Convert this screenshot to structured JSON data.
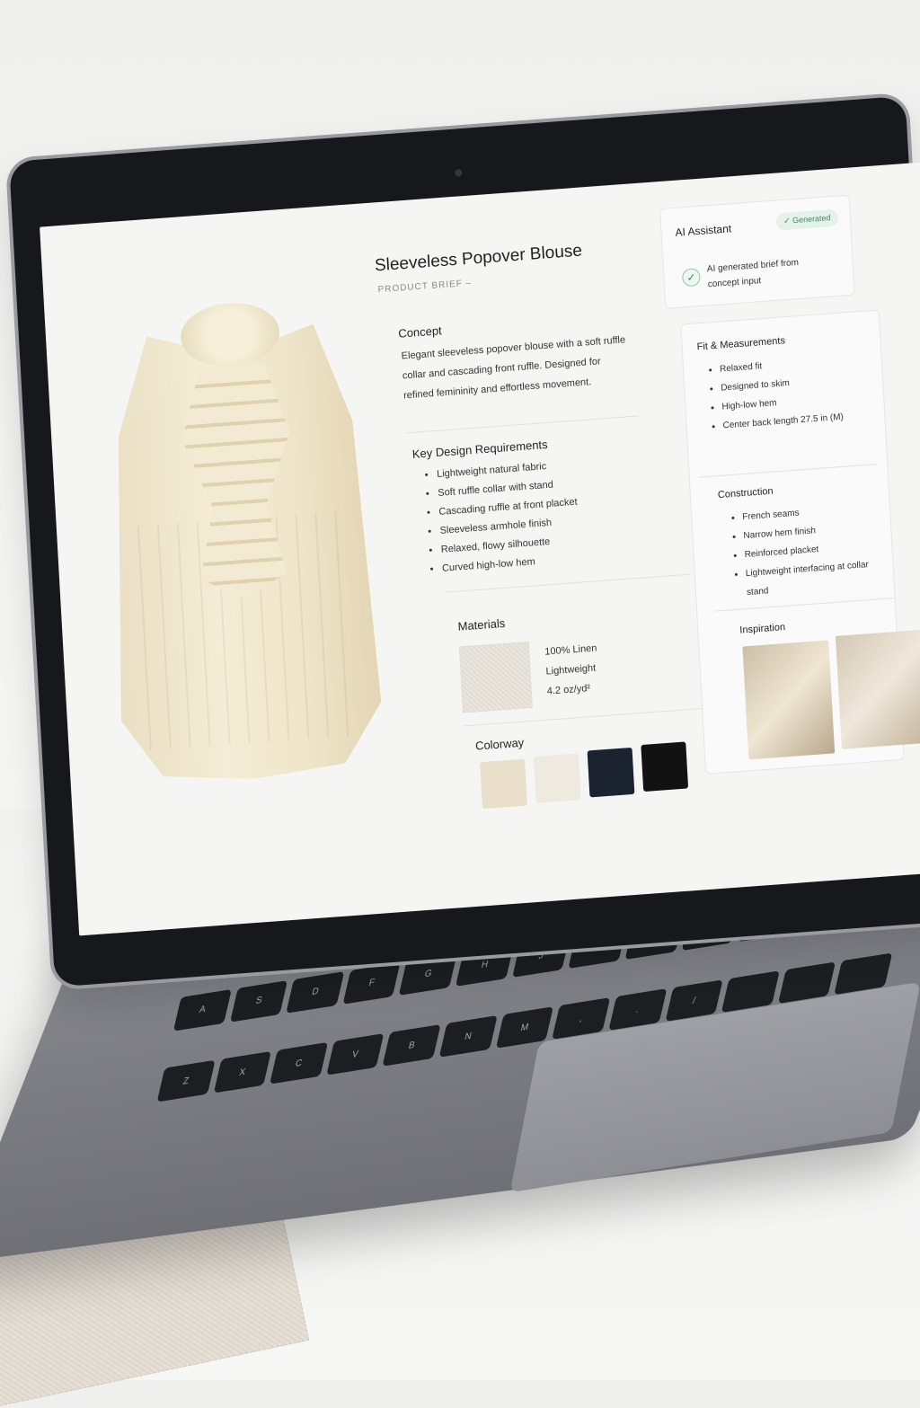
{
  "brief": {
    "title": "Sleeveless Popover Blouse",
    "subtitle": "PRODUCT BRIEF –",
    "concept": {
      "heading": "Concept",
      "text": "Elegant sleeveless popover blouse with a soft ruffle collar and cascading front ruffle. Designed for refined femininity and effortless movement."
    },
    "requirements": {
      "heading": "Key Design Requirements",
      "items": [
        "Lightweight natural fabric",
        "Soft ruffle collar with stand",
        "Cascading ruffle at front placket",
        "Sleeveless armhole finish",
        "Relaxed, flowy silhouette",
        "Curved high-low hem"
      ]
    },
    "materials": {
      "heading": "Materials",
      "lines": [
        "100% Linen",
        "Lightweight",
        "4.2 oz/yd²"
      ]
    },
    "colorway": {
      "heading": "Colorway",
      "colors": [
        "#e9dfca",
        "#eeeae0",
        "#1b2230",
        "#121212"
      ]
    }
  },
  "assistant": {
    "title": "AI Assistant",
    "badge": "Generated",
    "message": "AI generated brief from concept input"
  },
  "fit": {
    "heading": "Fit & Measurements",
    "items": [
      "Relaxed fit",
      "Designed to skim",
      "High-low hem",
      "Center back length 27.5 in (M)"
    ]
  },
  "construction": {
    "heading": "Construction",
    "items": [
      "French seams",
      "Narrow hem finish",
      "Reinforced placket",
      "Lightweight interfacing at collar stand"
    ]
  },
  "inspiration": {
    "heading": "Inspiration"
  },
  "icons": {
    "check": "check-icon",
    "badge_check": "check-icon",
    "camera": "camera-icon"
  }
}
